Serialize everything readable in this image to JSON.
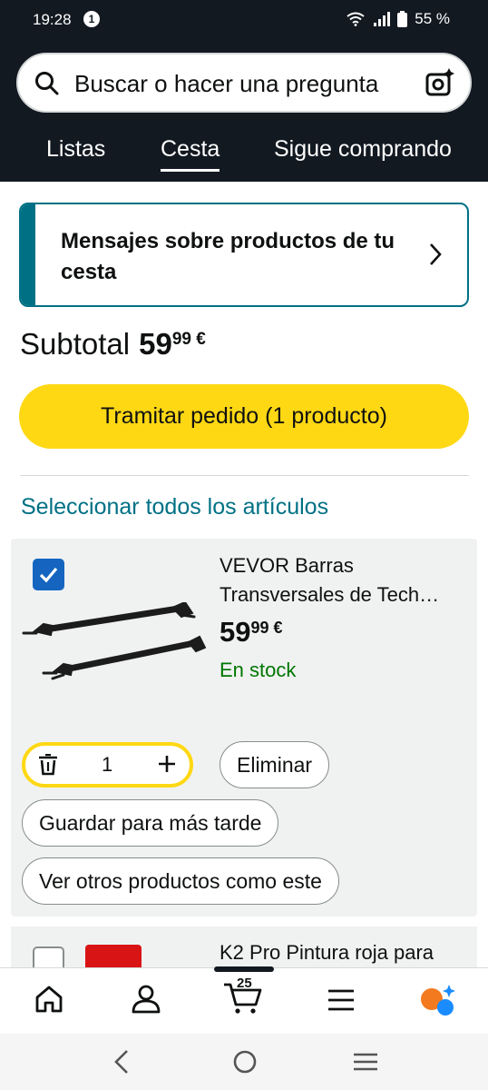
{
  "status": {
    "time": "19:28",
    "notifications": "1",
    "battery": "55 %"
  },
  "search": {
    "placeholder": "Buscar o hacer una pregunta"
  },
  "tabs": {
    "lists": "Listas",
    "cart": "Cesta",
    "continue": "Sigue comprando"
  },
  "alert": {
    "text": "Mensajes sobre productos de tu cesta"
  },
  "subtotal": {
    "label": "Subtotal",
    "price_main": "59",
    "price_cents": "99 €"
  },
  "checkout": {
    "label": "Tramitar pedido (1 producto)"
  },
  "select_all": "Seleccionar todos los artículos",
  "item": {
    "title_line1": "VEVOR Barras",
    "title_line2": "Transversales de Tech…",
    "price_main": "59",
    "price_cents": "99 €",
    "stock": "En stock",
    "quantity": "1",
    "delete_label": "Eliminar",
    "save_label": "Guardar para más tarde",
    "similar_label": "Ver otros productos como este"
  },
  "next_item": {
    "title": "K2 Pro Pintura roja para"
  },
  "nav": {
    "cart_count": "25"
  },
  "colors": {
    "header": "#131921",
    "accent": "#ffd814",
    "link": "#007185",
    "in_stock": "#007600"
  },
  "icons": [
    "search-icon",
    "lens-icon",
    "chevron-right-icon",
    "checkbox-icon",
    "trash-icon",
    "plus-icon",
    "home-icon",
    "user-icon",
    "cart-icon",
    "menu-icon",
    "assistant-icon",
    "back-icon",
    "home-circle-icon",
    "recents-icon"
  ]
}
